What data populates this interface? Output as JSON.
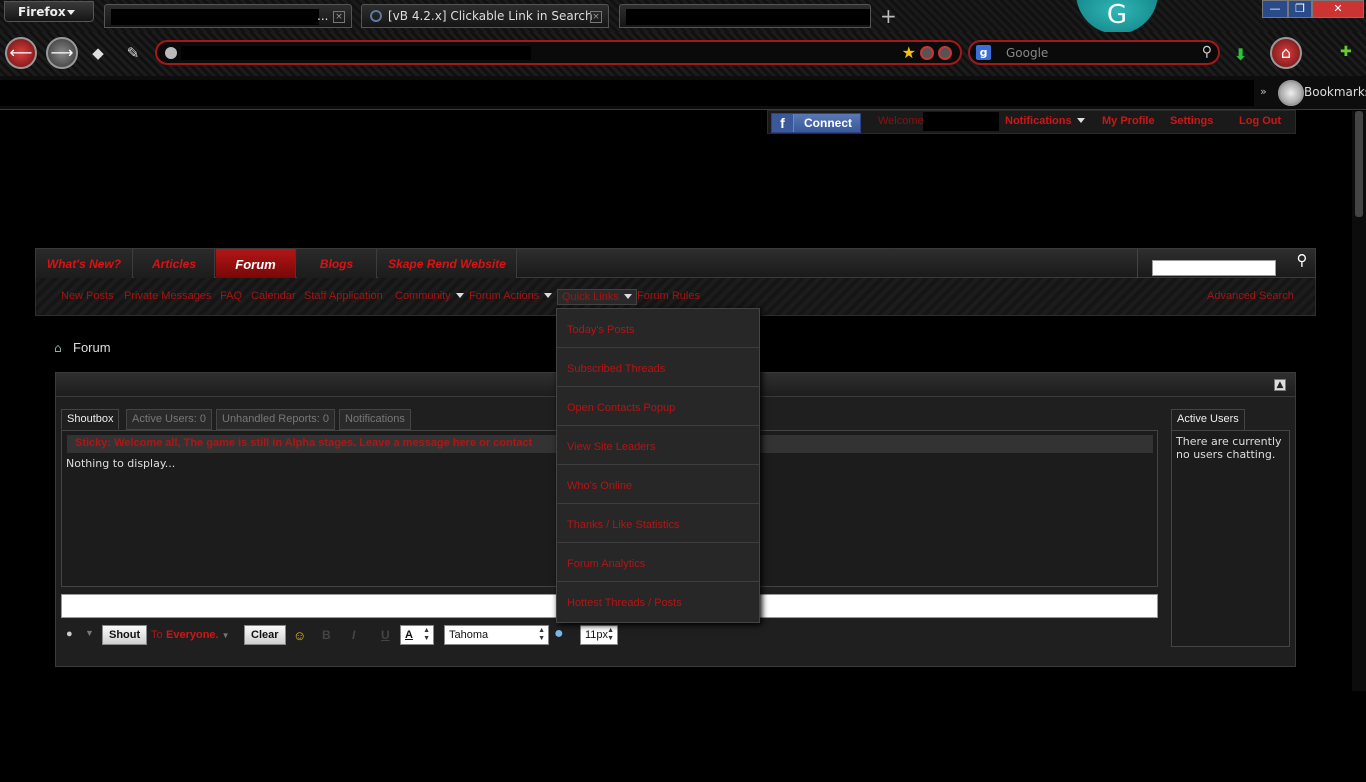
{
  "browser": {
    "menu_label": "Firefox",
    "tabs": [
      {
        "title": "...",
        "redacted": true
      },
      {
        "title": "[vB 4.2.x] Clickable Link in Search",
        "redacted": false
      },
      {
        "title": "",
        "redacted": true
      }
    ],
    "profile_initial": "G",
    "search_placeholder": "Google",
    "bookmarks_label": "Bookmarks"
  },
  "userbar": {
    "connect_label": "Connect",
    "welcome": "Welcome",
    "links": [
      "Notifications",
      "My Profile",
      "Settings",
      "Log Out"
    ]
  },
  "navtabs": [
    "What's New?",
    "Articles",
    "Forum",
    "Blogs",
    "Skape Rend Website"
  ],
  "active_tab": "Forum",
  "subnav": {
    "links": [
      "New Posts",
      "Private Messages",
      "FAQ",
      "Calendar",
      "Staff Application",
      "Community",
      "Forum Actions",
      "Quick Links",
      "Forum Rules"
    ],
    "advanced_search": "Advanced Search"
  },
  "quick_links_menu": [
    "Today's Posts",
    "Subscribed Threads",
    "Open Contacts Popup",
    "View Site Leaders",
    "Who's Online",
    "Thanks / Like Statistics",
    "Forum Analytics",
    "Hottest Threads / Posts"
  ],
  "breadcrumb": "Forum",
  "shoutbox": {
    "tabs": [
      "Shoutbox",
      "Active Users: 0",
      "Unhandled Reports: 0",
      "Notifications"
    ],
    "sticky": "Sticky: Welcome all, The game is still in Alpha stages. Leave a message here or contact",
    "empty_text": "Nothing to display...",
    "shout_button": "Shout",
    "to_label": "To",
    "everyone_label": "Everyone.",
    "clear_button": "Clear",
    "font_value": "Tahoma",
    "size_value": "11px",
    "bold_glyph": "B",
    "italic_glyph": "I",
    "underline_glyph": "U",
    "color_glyph": "A",
    "active_users_tab": "Active Users",
    "active_users_text": "There are currently no users chatting."
  },
  "colors": {
    "accent_red": "#d01515",
    "background": "#000000"
  }
}
